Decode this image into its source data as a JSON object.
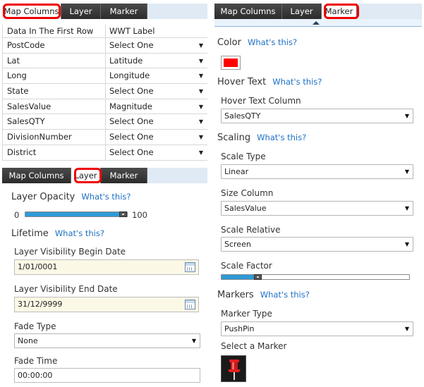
{
  "tabs": {
    "map_columns": "Map Columns",
    "layer": "Layer",
    "marker": "Marker"
  },
  "help_text": "What's this?",
  "map_columns": {
    "header": {
      "col1": "Data In The First Row",
      "col2": "WWT Label"
    },
    "rows": [
      {
        "name": "PostCode",
        "value": "Select One"
      },
      {
        "name": "Lat",
        "value": "Latitude"
      },
      {
        "name": "Long",
        "value": "Longitude"
      },
      {
        "name": "State",
        "value": "Select One"
      },
      {
        "name": "SalesValue",
        "value": "Magnitude"
      },
      {
        "name": "SalesQTY",
        "value": "Select One"
      },
      {
        "name": "DivisionNumber",
        "value": "Select One"
      },
      {
        "name": "District",
        "value": "Select One"
      }
    ]
  },
  "layer": {
    "opacity_title": "Layer Opacity",
    "opacity_min": "0",
    "opacity_max": "100",
    "opacity_value": 1.0,
    "lifetime_title": "Lifetime",
    "begin_label": "Layer Visibility Begin Date",
    "begin_value": "1/01/0001",
    "end_label": "Layer Visibility End Date",
    "end_value": "31/12/9999",
    "fade_type_label": "Fade Type",
    "fade_type_value": "None",
    "fade_time_label": "Fade Time",
    "fade_time_value": "00:00:00"
  },
  "marker": {
    "color_title": "Color",
    "color_value": "#ff0000",
    "hover_title": "Hover Text",
    "hover_column_label": "Hover Text Column",
    "hover_column_value": "SalesQTY",
    "scaling_title": "Scaling",
    "scale_type_label": "Scale Type",
    "scale_type_value": "Linear",
    "size_column_label": "Size Column",
    "size_column_value": "SalesValue",
    "scale_relative_label": "Scale Relative",
    "scale_relative_value": "Screen",
    "scale_factor_label": "Scale Factor",
    "scale_factor_value": 0.18,
    "markers_title": "Markers",
    "marker_type_label": "Marker Type",
    "marker_type_value": "PushPin",
    "select_marker_label": "Select a Marker"
  },
  "colors": {
    "highlight": "#e00000",
    "link": "#1d6fc5",
    "slider_fill": "#2e9ad8",
    "tab_dark": "#333333",
    "date_bg": "#fbf8e6"
  }
}
